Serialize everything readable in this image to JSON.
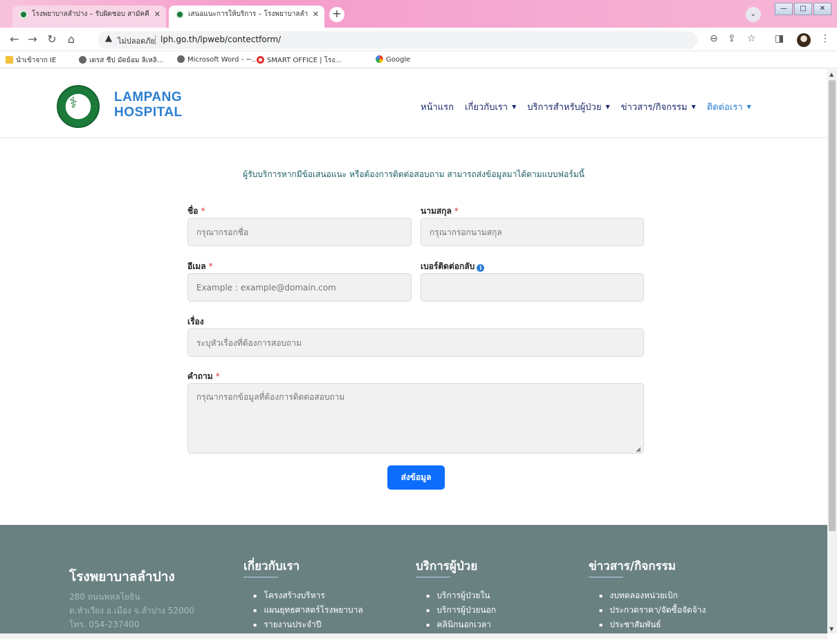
{
  "browser": {
    "tabs": [
      {
        "title": "โรงพยาบาลลำปาง – รับผิดชอบ สามัคคี"
      },
      {
        "title": "เสนอแนะการให้บริการ – โรงพยาบาลลำ"
      }
    ],
    "new_tab": "+",
    "security_label": "ไม่ปลอดภัย",
    "url": "lph.go.th/lpweb/contectform/",
    "bookmarks": [
      {
        "label": "นำเข้าจาก IE"
      },
      {
        "label": "เดรส ชีป มัดย้อม ลิเหลิ..."
      },
      {
        "label": "Microsoft Word - ~..."
      },
      {
        "label": "SMART OFFICE | โรง..."
      },
      {
        "label": "Google"
      }
    ]
  },
  "site": {
    "brand_line1": "LAMPANG",
    "brand_line2": "HOSPITAL",
    "nav": [
      {
        "label": "หน้าแรก"
      },
      {
        "label": "เกี่ยวกับเรา"
      },
      {
        "label": "บริการสำหรับผู้ป่วย"
      },
      {
        "label": "ข่าวสาร/กิจกรรม"
      },
      {
        "label": "ติดต่อเรา"
      }
    ]
  },
  "form": {
    "intro": "ผู้รับบริการหากมีข้อเสนอแนะ หรือต้องการติดต่อสอบถาม สามารถส่งข้อมูลมาได้ตามแบบฟอร์มนี้",
    "first_name": {
      "label": "ชื่อ",
      "placeholder": "กรุณากรอกชื่อ",
      "value": ""
    },
    "last_name": {
      "label": "นามสกุล",
      "placeholder": "กรุณากรอกนามสกุล",
      "value": ""
    },
    "email": {
      "label": "อีเมล",
      "placeholder": "Example : example@domain.com",
      "value": ""
    },
    "phone": {
      "label": "เบอร์ติดต่อกลับ",
      "placeholder": "",
      "value": ""
    },
    "subject": {
      "label": "เรื่อง",
      "placeholder": "ระบุหัวเรื่องที่ต้องการสอบถาม",
      "value": ""
    },
    "question": {
      "label": "คำถาม",
      "placeholder": "กรุณากรอกข้อมูลที่ต้องการติดต่อสอบถาม",
      "value": ""
    },
    "required_mark": "*",
    "submit_label": "ส่งข้อมูล"
  },
  "footer": {
    "org_name": "โรงพยาบาลลำปาง",
    "address_lines": [
      "280 ถนนพหลโยธิน",
      "ต.หัวเวียง อ.เมือง จ.ลำปาง 52000",
      "โทร. 054-237400"
    ],
    "col_about": {
      "title": "เกี่ยวกับเรา",
      "items": [
        "โครงสร้างบริหาร",
        "แผนยุทธศาสตร์โรงพยาบาล",
        "รายงานประจำปี"
      ]
    },
    "col_service": {
      "title": "บริการผู้ป่วย",
      "items": [
        "บริการผู้ป่วยใน",
        "บริการผู้ป่วยนอก",
        "คลินิกนอกเวลา"
      ]
    },
    "col_news": {
      "title": "ข่าวสาร/กิจกรรม",
      "items": [
        "งบทดลองหน่วยเบิก",
        "ประกวดราคา/จัดซื้อจัดจ้าง",
        "ประชาสัมพันธ์"
      ]
    }
  },
  "colors": {
    "brand_blue": "#2b7fd1",
    "footer_bg": "#6a8182",
    "submit_bg": "#0d6efd",
    "logo_green": "#1c7a3a"
  }
}
